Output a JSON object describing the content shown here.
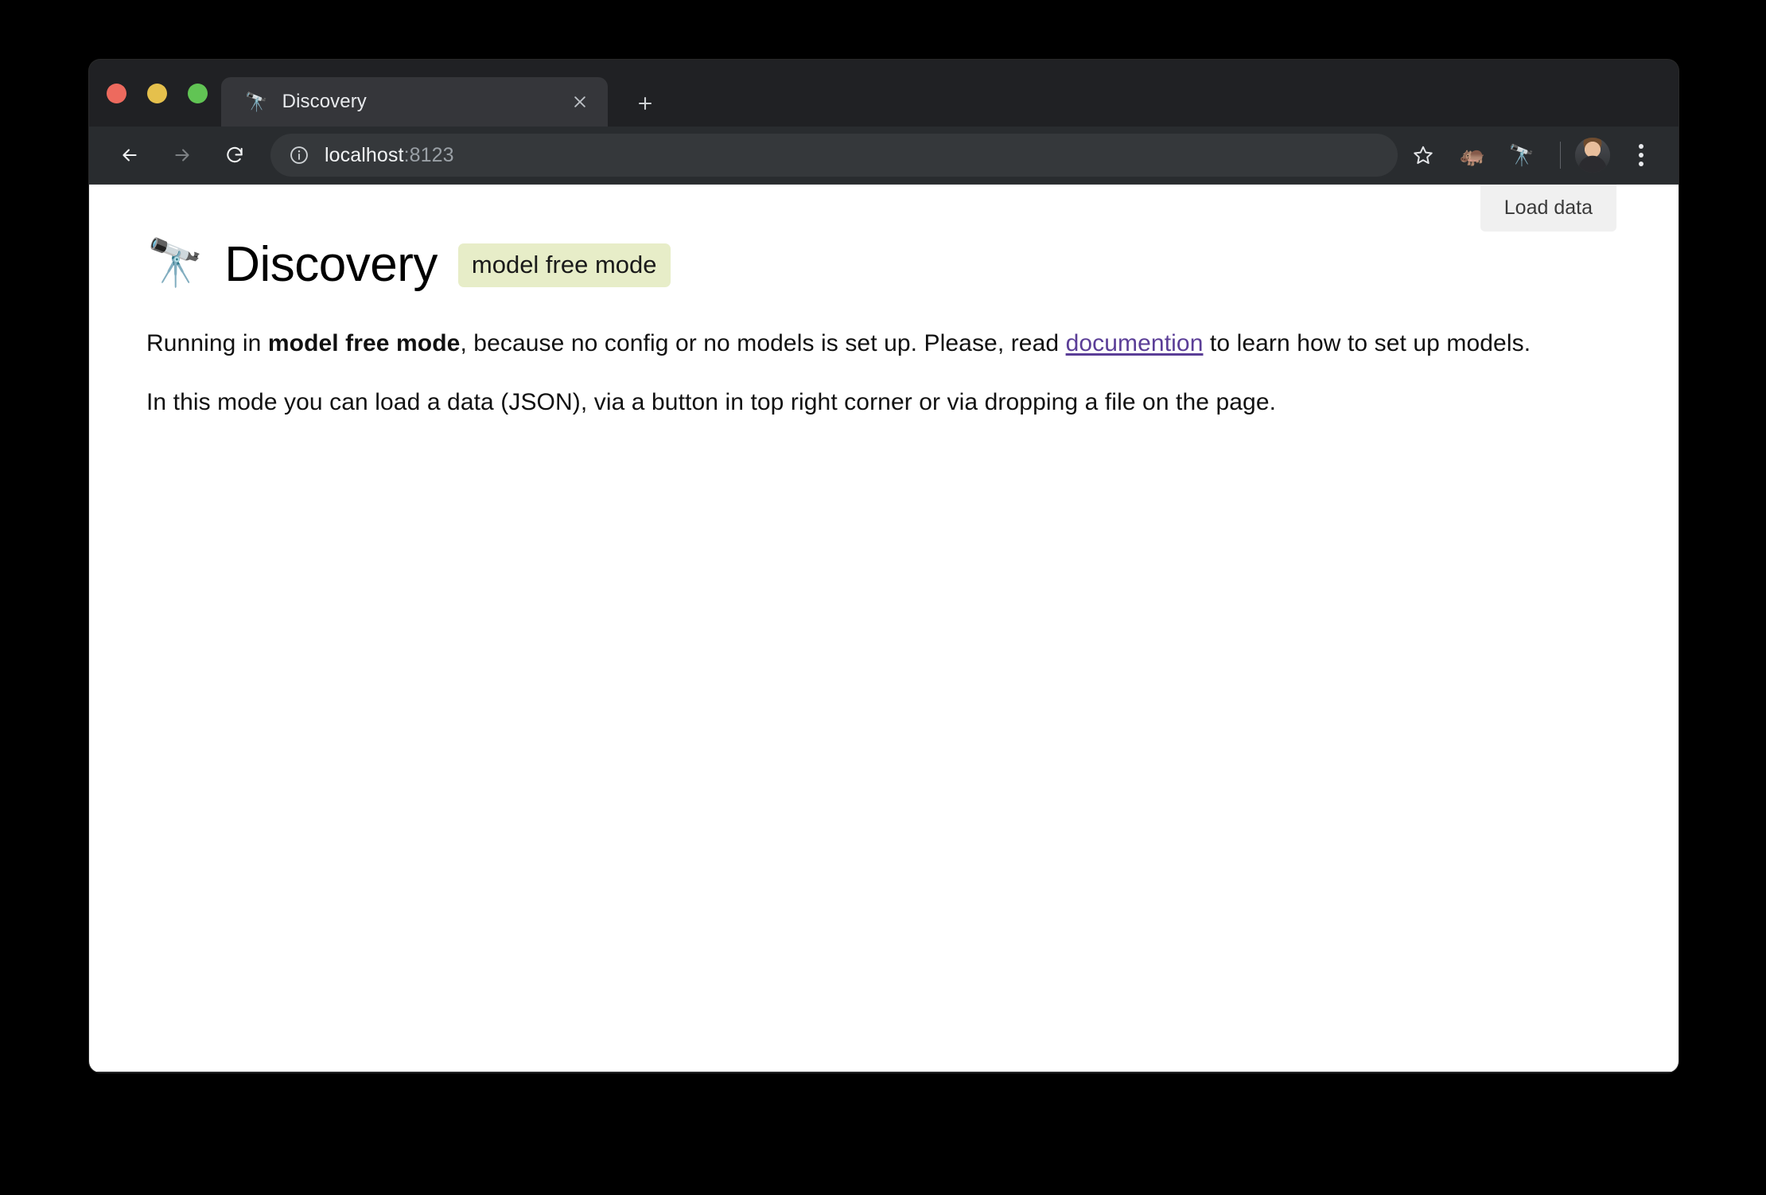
{
  "browser": {
    "traffic_lights": [
      {
        "name": "close",
        "color": "#ED6A5E"
      },
      {
        "name": "minimize",
        "color": "#E5C04C"
      },
      {
        "name": "maximize",
        "color": "#61C454"
      }
    ],
    "tab": {
      "title": "Discovery",
      "favicon": "telescope-icon",
      "close_label": "×"
    },
    "new_tab_label": "+",
    "nav": {
      "back": "back-arrow-icon",
      "forward": "forward-arrow-icon",
      "reload": "reload-icon"
    },
    "omnibox": {
      "site_info_icon": "info-circle-icon",
      "host": "localhost",
      "port": ":8123",
      "full_url": "localhost:8123"
    },
    "actions": {
      "bookmark": "star-icon",
      "extension_1": "hippo-icon",
      "extension_1_glyph": "🦛",
      "extension_2": "telescope-icon",
      "extension_2_glyph": "🔭",
      "profile": "avatar",
      "menu": "three-dot-menu-icon"
    }
  },
  "page": {
    "load_data_label": "Load data",
    "logo_glyph": "🔭",
    "title": "Discovery",
    "badge": "model free mode",
    "paragraph1": {
      "before_bold": "Running in ",
      "bold": "model free mode",
      "after_bold": ", because no config or no models is set up. Please, read ",
      "link": "documention",
      "tail": " to learn how to set up models."
    },
    "paragraph2": "In this mode you can load a data (JSON), via a button in top right corner or via dropping a file on the page."
  }
}
